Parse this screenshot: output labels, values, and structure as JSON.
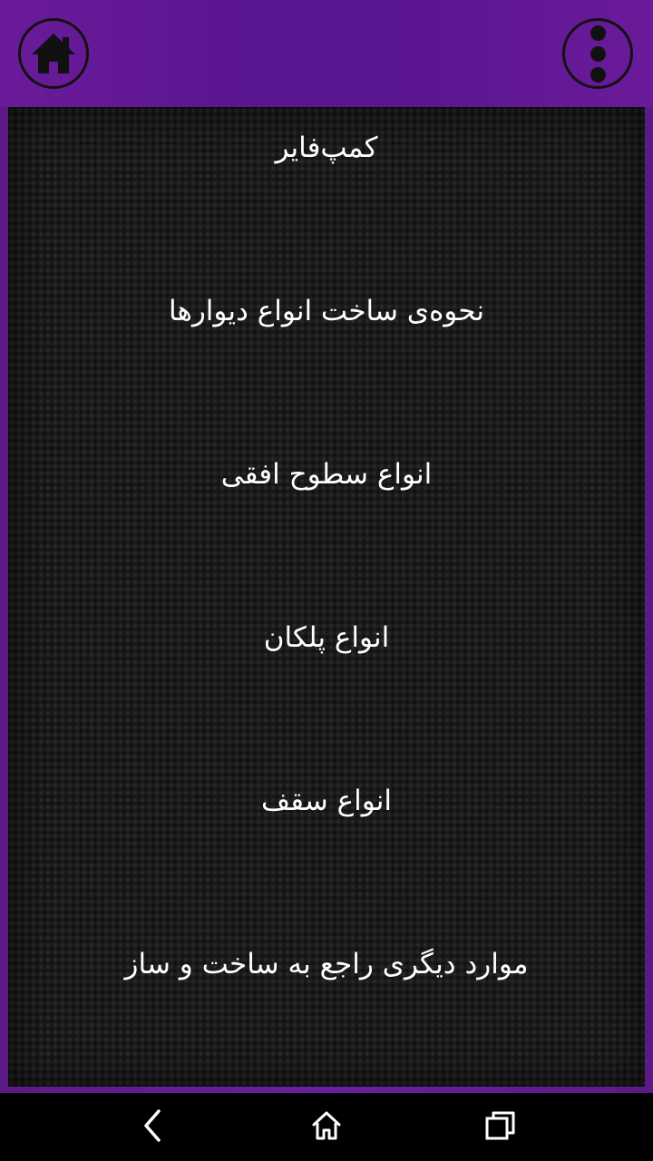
{
  "header": {
    "home_icon": "home-icon",
    "menu_icon": "overflow-menu-icon"
  },
  "menu": {
    "items": [
      {
        "label": "کمپ‌فایر"
      },
      {
        "label": "نحوه‌ی ساخت انواع دیوارها"
      },
      {
        "label": "انواع سطوح افقی"
      },
      {
        "label": "انواع پلکان"
      },
      {
        "label": "انواع سقف"
      },
      {
        "label": "موارد دیگری راجع به ساخت و ساز"
      }
    ]
  },
  "navbar": {
    "back_icon": "back-icon",
    "home_icon": "home-outline-icon",
    "recents_icon": "recent-apps-icon"
  },
  "colors": {
    "header_purple": "#5a1590",
    "frame_purple": "#6b1fa0",
    "panel_dark": "#1a1a1a",
    "text": "#ffffff",
    "icon_dark": "#111111"
  }
}
